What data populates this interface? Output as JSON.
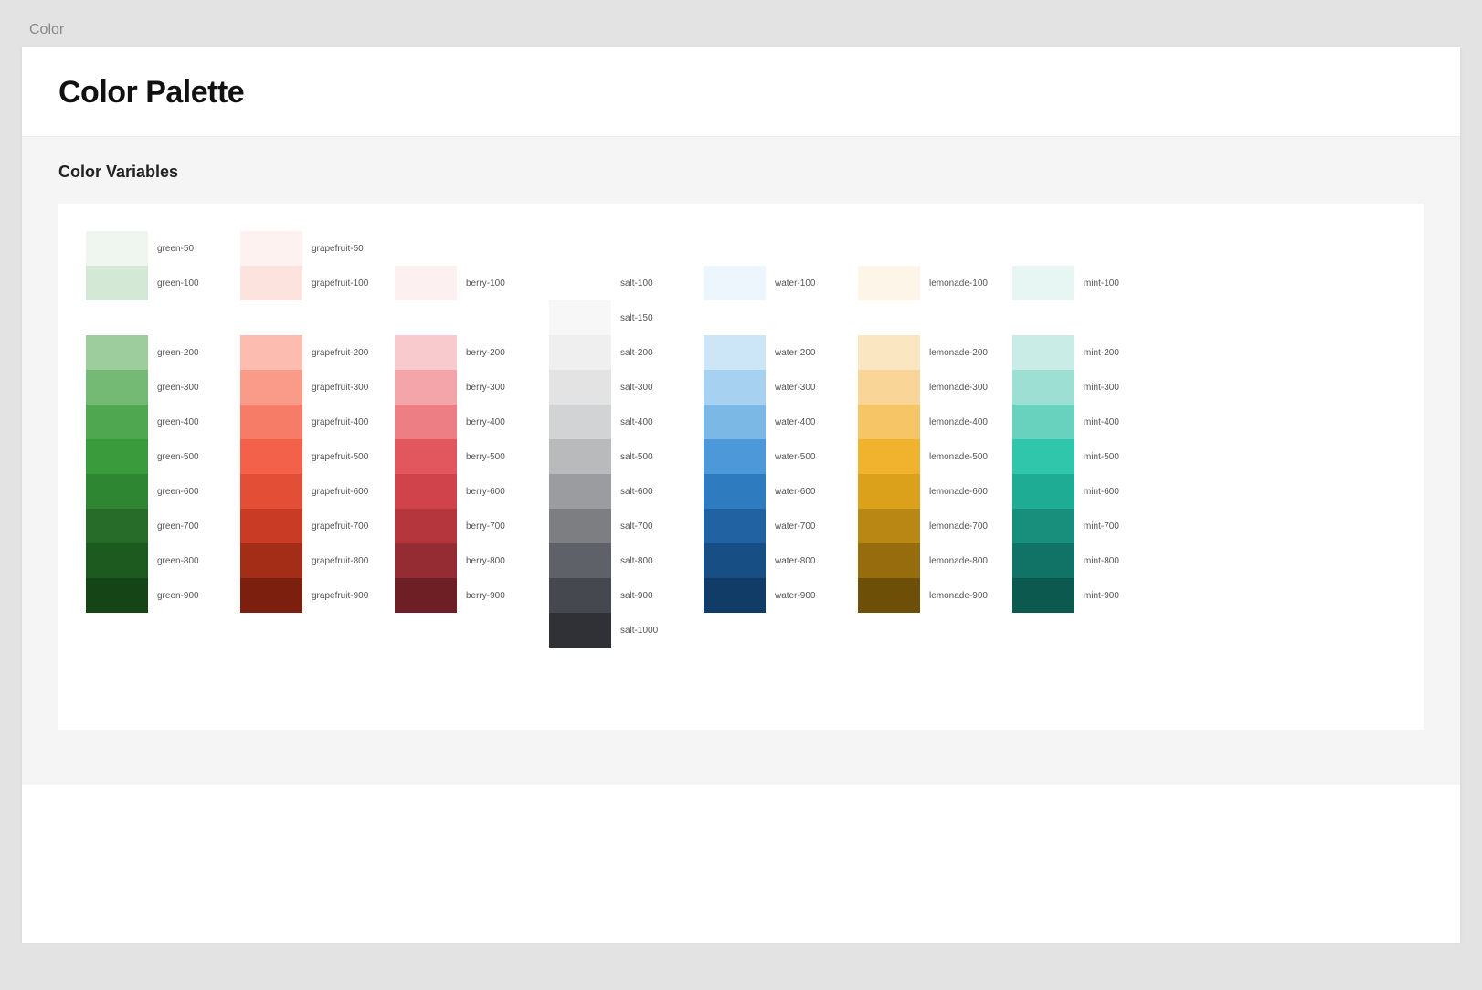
{
  "breadcrumb": "Color",
  "page_title": "Color Palette",
  "section_title": "Color Variables",
  "columns": [
    {
      "name": "green",
      "top": [
        {
          "label": "green-50",
          "hex": "#eef6ef"
        },
        {
          "label": "green-100",
          "hex": "#d3e8d5"
        }
      ],
      "main": [
        {
          "label": "green-200",
          "hex": "#9ecd9d"
        },
        {
          "label": "green-300",
          "hex": "#74ba74"
        },
        {
          "label": "green-400",
          "hex": "#4fa750"
        },
        {
          "label": "green-500",
          "hex": "#3a9b3d"
        },
        {
          "label": "green-600",
          "hex": "#2f8632"
        },
        {
          "label": "green-700",
          "hex": "#276d29"
        },
        {
          "label": "green-800",
          "hex": "#1d5a1f"
        },
        {
          "label": "green-900",
          "hex": "#154517"
        }
      ]
    },
    {
      "name": "grapefruit",
      "top": [
        {
          "label": "grapefruit-50",
          "hex": "#fdf2f0"
        },
        {
          "label": "grapefruit-100",
          "hex": "#fde3dd"
        }
      ],
      "main": [
        {
          "label": "grapefruit-200",
          "hex": "#fcbcb0"
        },
        {
          "label": "grapefruit-300",
          "hex": "#fa9a89"
        },
        {
          "label": "grapefruit-400",
          "hex": "#f77c67"
        },
        {
          "label": "grapefruit-500",
          "hex": "#f3614a"
        },
        {
          "label": "grapefruit-600",
          "hex": "#e24e36"
        },
        {
          "label": "grapefruit-700",
          "hex": "#c93b24"
        },
        {
          "label": "grapefruit-800",
          "hex": "#a42d18"
        },
        {
          "label": "grapefruit-900",
          "hex": "#7d1f0e"
        }
      ]
    },
    {
      "name": "berry",
      "top": [
        null,
        {
          "label": "berry-100",
          "hex": "#fdf0f0"
        }
      ],
      "main": [
        {
          "label": "berry-200",
          "hex": "#f8cacd"
        },
        {
          "label": "berry-300",
          "hex": "#f3a5aa"
        },
        {
          "label": "berry-400",
          "hex": "#ec7e84"
        },
        {
          "label": "berry-500",
          "hex": "#e1575d"
        },
        {
          "label": "berry-600",
          "hex": "#d0434a"
        },
        {
          "label": "berry-700",
          "hex": "#b5363d"
        },
        {
          "label": "berry-800",
          "hex": "#952c33"
        },
        {
          "label": "berry-900",
          "hex": "#6e1e25"
        }
      ]
    },
    {
      "name": "salt",
      "top": [
        null,
        {
          "label": "salt-100",
          "hex": "#ffffff"
        }
      ],
      "extra_top": [
        {
          "label": "salt-150",
          "hex": "#f7f7f7"
        }
      ],
      "main": [
        {
          "label": "salt-200",
          "hex": "#efefef"
        },
        {
          "label": "salt-300",
          "hex": "#e3e3e4"
        },
        {
          "label": "salt-400",
          "hex": "#d2d3d4"
        },
        {
          "label": "salt-500",
          "hex": "#b9babc"
        },
        {
          "label": "salt-600",
          "hex": "#9a9ca0"
        },
        {
          "label": "salt-700",
          "hex": "#7c7e82"
        },
        {
          "label": "salt-800",
          "hex": "#5e6167"
        },
        {
          "label": "salt-900",
          "hex": "#45484e"
        },
        {
          "label": "salt-1000",
          "hex": "#2f3137"
        }
      ]
    },
    {
      "name": "water",
      "top": [
        null,
        {
          "label": "water-100",
          "hex": "#edf6fc"
        }
      ],
      "main": [
        {
          "label": "water-200",
          "hex": "#cde6f7"
        },
        {
          "label": "water-300",
          "hex": "#a6d1f0"
        },
        {
          "label": "water-400",
          "hex": "#7cb8e6"
        },
        {
          "label": "water-500",
          "hex": "#4d98d9"
        },
        {
          "label": "water-600",
          "hex": "#2f7bc0"
        },
        {
          "label": "water-700",
          "hex": "#2163a2"
        },
        {
          "label": "water-800",
          "hex": "#174f85"
        },
        {
          "label": "water-900",
          "hex": "#103c67"
        }
      ]
    },
    {
      "name": "lemonade",
      "top": [
        null,
        {
          "label": "lemonade-100",
          "hex": "#fdf5e7"
        }
      ],
      "main": [
        {
          "label": "lemonade-200",
          "hex": "#fbe6c2"
        },
        {
          "label": "lemonade-300",
          "hex": "#f9d698"
        },
        {
          "label": "lemonade-400",
          "hex": "#f6c666"
        },
        {
          "label": "lemonade-500",
          "hex": "#f1b32e"
        },
        {
          "label": "lemonade-600",
          "hex": "#dba11a"
        },
        {
          "label": "lemonade-700",
          "hex": "#b98713"
        },
        {
          "label": "lemonade-800",
          "hex": "#966c0d"
        },
        {
          "label": "lemonade-900",
          "hex": "#6e4f07"
        }
      ]
    },
    {
      "name": "mint",
      "top": [
        null,
        {
          "label": "mint-100",
          "hex": "#e8f6f3"
        }
      ],
      "main": [
        {
          "label": "mint-200",
          "hex": "#c9ece6"
        },
        {
          "label": "mint-300",
          "hex": "#9edfd4"
        },
        {
          "label": "mint-400",
          "hex": "#69d2bf"
        },
        {
          "label": "mint-500",
          "hex": "#2fc6ab"
        },
        {
          "label": "mint-600",
          "hex": "#1fac94"
        },
        {
          "label": "mint-700",
          "hex": "#188f7d"
        },
        {
          "label": "mint-800",
          "hex": "#117366"
        },
        {
          "label": "mint-900",
          "hex": "#0b594f"
        }
      ]
    }
  ]
}
